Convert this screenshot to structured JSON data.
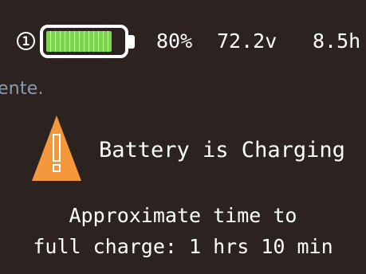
{
  "page": {
    "background_color": "#2c221f",
    "bleed_text": "ente."
  },
  "status": {
    "battery_index": "1",
    "battery_level": 0.8,
    "battery_fill_color": "#7cd34f",
    "percent": "80%",
    "voltage": "72.2v",
    "runtime": "8.5h"
  },
  "alert": {
    "icon": "warning-icon",
    "icon_color": "#f5983b",
    "message": "Battery is Charging"
  },
  "eta": {
    "line1": "Approximate time to",
    "line2": "full charge: 1 hrs 10 min"
  }
}
